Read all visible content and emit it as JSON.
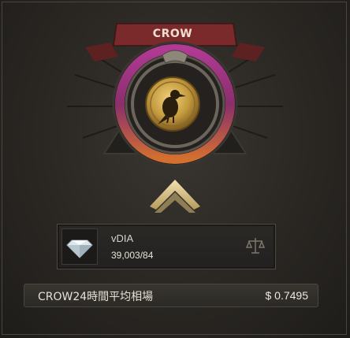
{
  "emblem": {
    "banner_label": "CROW",
    "symbol": "crow-icon"
  },
  "item": {
    "name": "vDIA",
    "count": "39,003/84",
    "icon": "diamond-icon",
    "action_icon": "scale-icon"
  },
  "price": {
    "label": "CROW24時間平均相場",
    "value": "$ 0.7495"
  },
  "colors": {
    "banner": "#7a2a2a",
    "gold": "#c9a24a",
    "ring_purple": "#a6338e",
    "ring_orange": "#d36a2f"
  }
}
